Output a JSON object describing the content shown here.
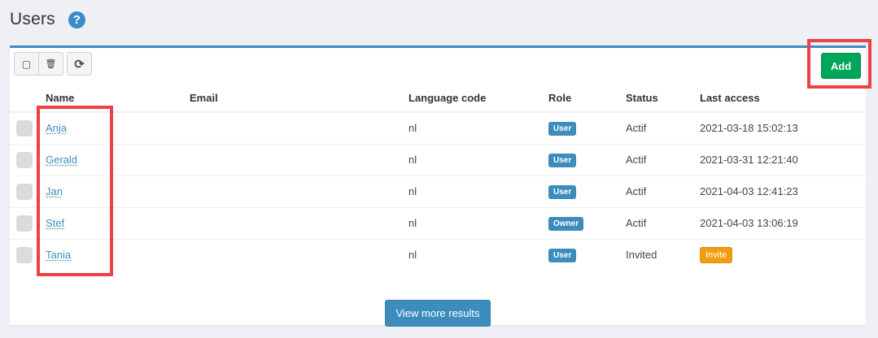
{
  "header": {
    "title": "Users",
    "help_icon": "?"
  },
  "toolbar": {
    "select_all_icon": "▢",
    "delete_icon": "🗑",
    "refresh_icon": "⟳",
    "add_label": "Add"
  },
  "table": {
    "columns": [
      "Name",
      "Email",
      "Language code",
      "Role",
      "Status",
      "Last access"
    ],
    "rows": [
      {
        "name": "Anja",
        "email": "",
        "language": "nl",
        "role": "User",
        "status": "Actif",
        "last_access": "2021-03-18 15:02:13"
      },
      {
        "name": "Gerald",
        "email": "",
        "language": "nl",
        "role": "User",
        "status": "Actif",
        "last_access": "2021-03-31 12:21:40"
      },
      {
        "name": "Jan",
        "email": "",
        "language": "nl",
        "role": "User",
        "status": "Actif",
        "last_access": "2021-04-03 12:41:23"
      },
      {
        "name": "Stef",
        "email": "",
        "language": "nl",
        "role": "Owner",
        "status": "Actif",
        "last_access": "2021-04-03 13:06:19"
      },
      {
        "name": "Tania",
        "email": "",
        "language": "nl",
        "role": "User",
        "status": "Invited",
        "last_access": "Invite"
      }
    ]
  },
  "footer": {
    "more_label": "View more results"
  },
  "colors": {
    "accent": "#3c8dbc",
    "success": "#00a65a",
    "warning": "#f39c12",
    "highlight": "#ef3f47"
  }
}
